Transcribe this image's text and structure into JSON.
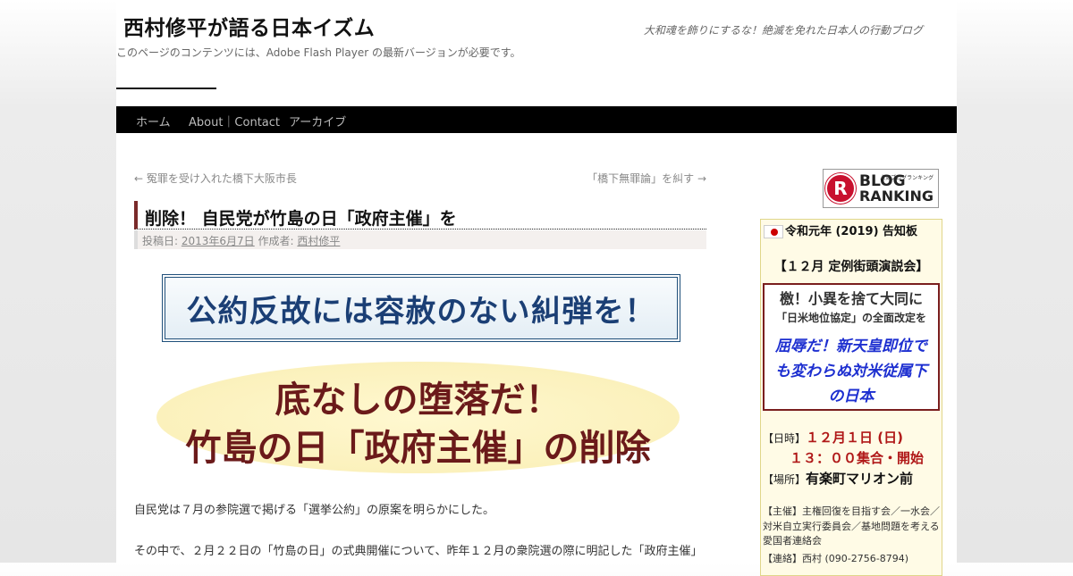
{
  "header": {
    "site_title": "西村修平が語る日本イズム",
    "site_description": "大和魂を飾りにするな！絶滅を免れた日本人の行動ブログ",
    "flash_notice": "このページのコンテンツには、Adobe Flash Player の最新バージョンが必要です。"
  },
  "nav": {
    "items": [
      {
        "label": "ホーム"
      },
      {
        "label": "About｜Contact"
      },
      {
        "label": "アーカイブ"
      }
    ]
  },
  "post_nav": {
    "prev": "← 冤罪を受け入れた橋下大阪市長",
    "next": "「橋下無罪論」を糾す →"
  },
  "post": {
    "title": "削除！ 自民党が竹島の日「政府主催」を",
    "meta_posted_label": "投稿日:",
    "meta_date": "2013年6月7日",
    "meta_author_label": "作成者:",
    "meta_author": "西村修平",
    "banner1_text": "公約反故には容赦のない糾弾を！",
    "banner2_line1": "底なしの堕落だ！",
    "banner2_line2": "竹島の日「政府主催」の削除",
    "paragraph1": "自民党は７月の参院選で掲げる「選挙公約」の原案を明らかにした。",
    "paragraph2": "その中で、２月２２日の「竹島の日」の式典開催について、昨年１２月の衆院選の際に明記した「政府主催」"
  },
  "sidebar": {
    "ranking_banner": {
      "line1": "BLOG",
      "line2": "RANKING",
      "sub": "人気ブログランキング"
    },
    "notice_title": "令和元年 (2019) 告知板",
    "event_heading": "【１２月 定例街頭演説会】",
    "event_line1": "檄！小異を捨て大同に",
    "event_line2": "「日米地位協定」の全面改定を",
    "event_line3a": "屈辱だ！新天皇即位で",
    "event_line3b": "も変わらぬ対米従属下",
    "event_line3c": "の日本",
    "date_label": "【日時】",
    "date_value": "１２月１日 (日)",
    "time_value": "１３：００集合・開始",
    "place_label": "【場所】",
    "place_value": "有楽町マリオン前",
    "host_text": "【主催】主権回復を目指す会／一水会／対米自立実行委員会／基地問題を考える愛国者連絡会",
    "contact_text": "【連絡】西村 (090-2756-8794)"
  }
}
